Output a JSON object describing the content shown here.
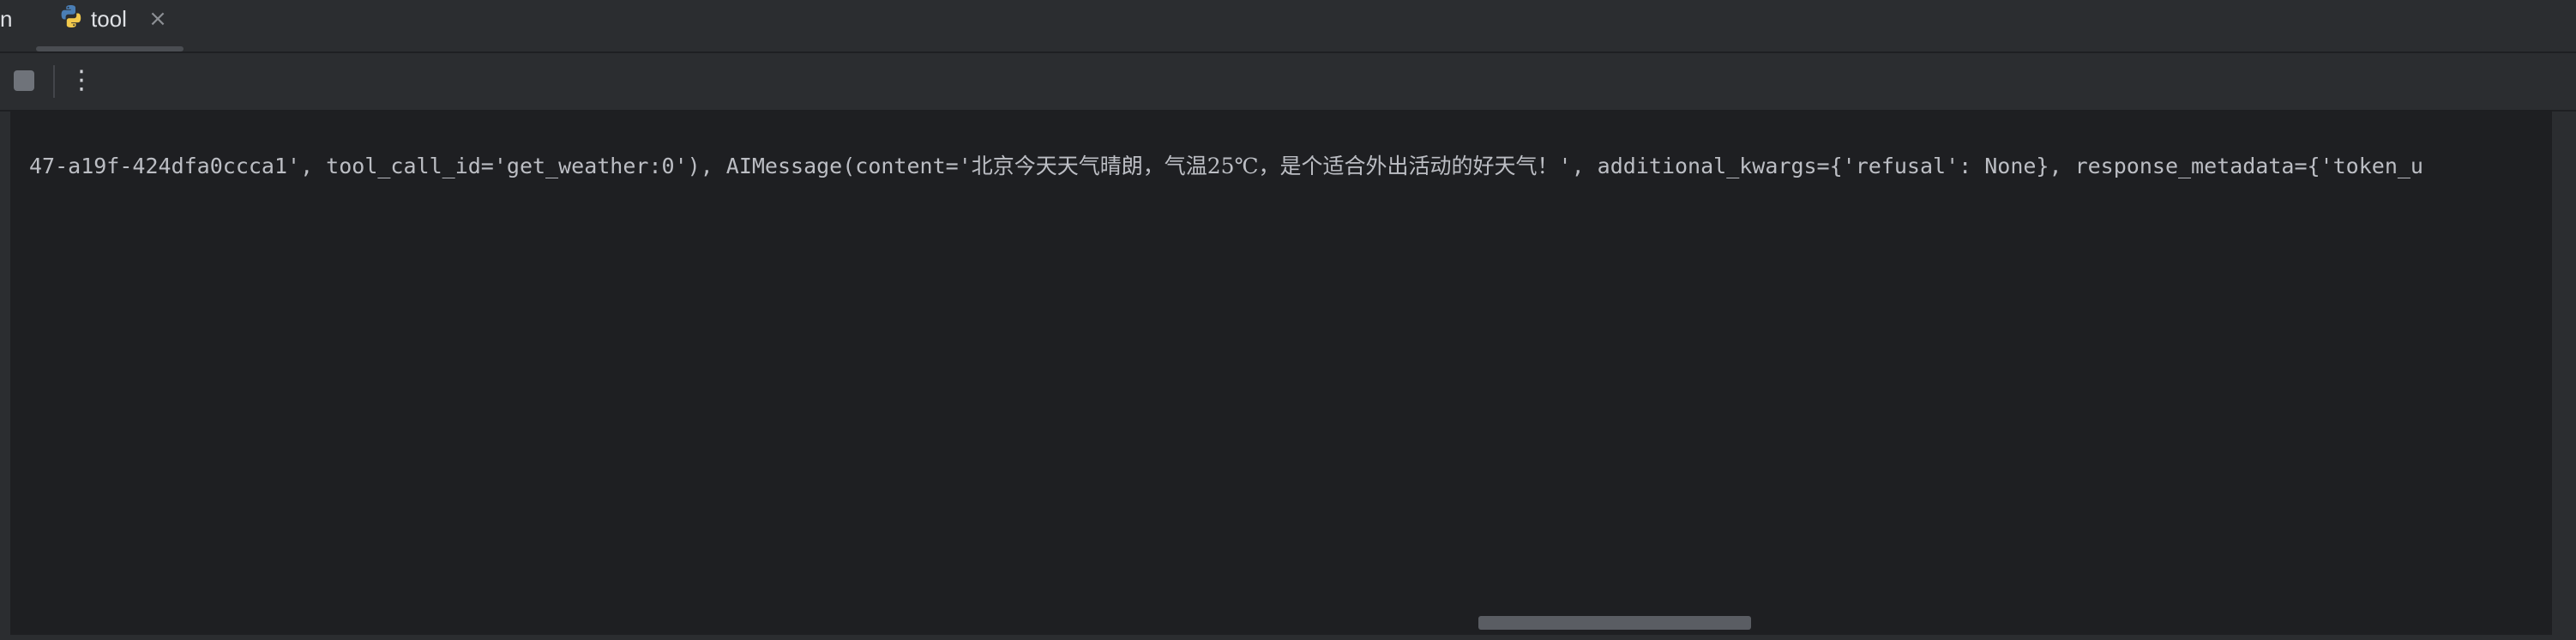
{
  "tabs": {
    "previous_tab_fragment": "n",
    "active": {
      "label": "tool",
      "icon": "python-file-icon",
      "close_glyph": "×"
    }
  },
  "toolbar": {
    "stop_icon": "stop-icon",
    "more_glyph": "⋮"
  },
  "console": {
    "line_prefix": "47-a19f-424dfa0ccca1', tool_call_id='get_weather:0'), AIMessage(content='",
    "line_cjk": "北京今天天气晴朗，气温25℃，是个适合外出活动的好天气！",
    "line_suffix": "', additional_kwargs={'refusal': None}, response_metadata={'token_u"
  },
  "colors": {
    "background": "#1e1f22",
    "panel": "#2b2d30",
    "text": "#bcbec4"
  }
}
